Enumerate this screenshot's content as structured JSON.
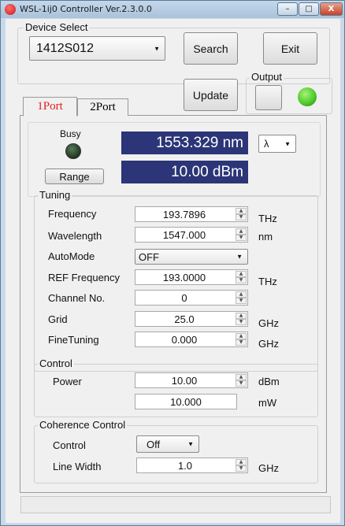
{
  "window": {
    "title": "WSL-1ĳ0 Controller Ver.2.3.0.0",
    "controls": {
      "minimize": "–",
      "maximize": "□",
      "close": "X"
    }
  },
  "device": {
    "label": "Device Select",
    "selected": "1412S012",
    "search_label": "Search",
    "exit_label": "Exit"
  },
  "update_label": "Update",
  "output": {
    "label": "Output",
    "led_color": "#4fcc2c"
  },
  "tabs": [
    {
      "label": "1Port",
      "active": true,
      "color": "#e0201c"
    },
    {
      "label": "2Port",
      "active": false,
      "color": "#111111"
    }
  ],
  "port": {
    "busy_label": "Busy",
    "busy_led_color": "#2a4a2a",
    "range_label": "Range",
    "wavelength_display": "1553.329 nm",
    "power_display": "10.00 dBm",
    "display_color": "#2b3577",
    "unit_select": "λ"
  },
  "tuning": {
    "title": "Tuning",
    "rows": [
      {
        "label": "Frequency",
        "value": "193.7896",
        "unit": "THz"
      },
      {
        "label": "Wavelength",
        "value": "1547.000",
        "unit": "nm"
      },
      {
        "label": "AutoMode",
        "value": "OFF",
        "unit": ""
      },
      {
        "label": "REF Frequency",
        "value": "193.0000",
        "unit": "THz"
      },
      {
        "label": "Channel No.",
        "value": "0",
        "unit": ""
      },
      {
        "label": "Grid",
        "value": "25.0",
        "unit": "GHz"
      },
      {
        "label": "FineTuning",
        "value": "0.000",
        "unit": "GHz"
      }
    ]
  },
  "control": {
    "title": "Control",
    "power_label": "Power",
    "power_dbm": "10.00",
    "unit_dbm": "dBm",
    "power_mw": "10.000",
    "unit_mw": "mW"
  },
  "coherence": {
    "title": "Coherence Control",
    "control_label": "Control",
    "control_value": "Off",
    "linewidth_label": "Line Width",
    "linewidth_value": "1.0",
    "linewidth_unit": "GHz"
  }
}
